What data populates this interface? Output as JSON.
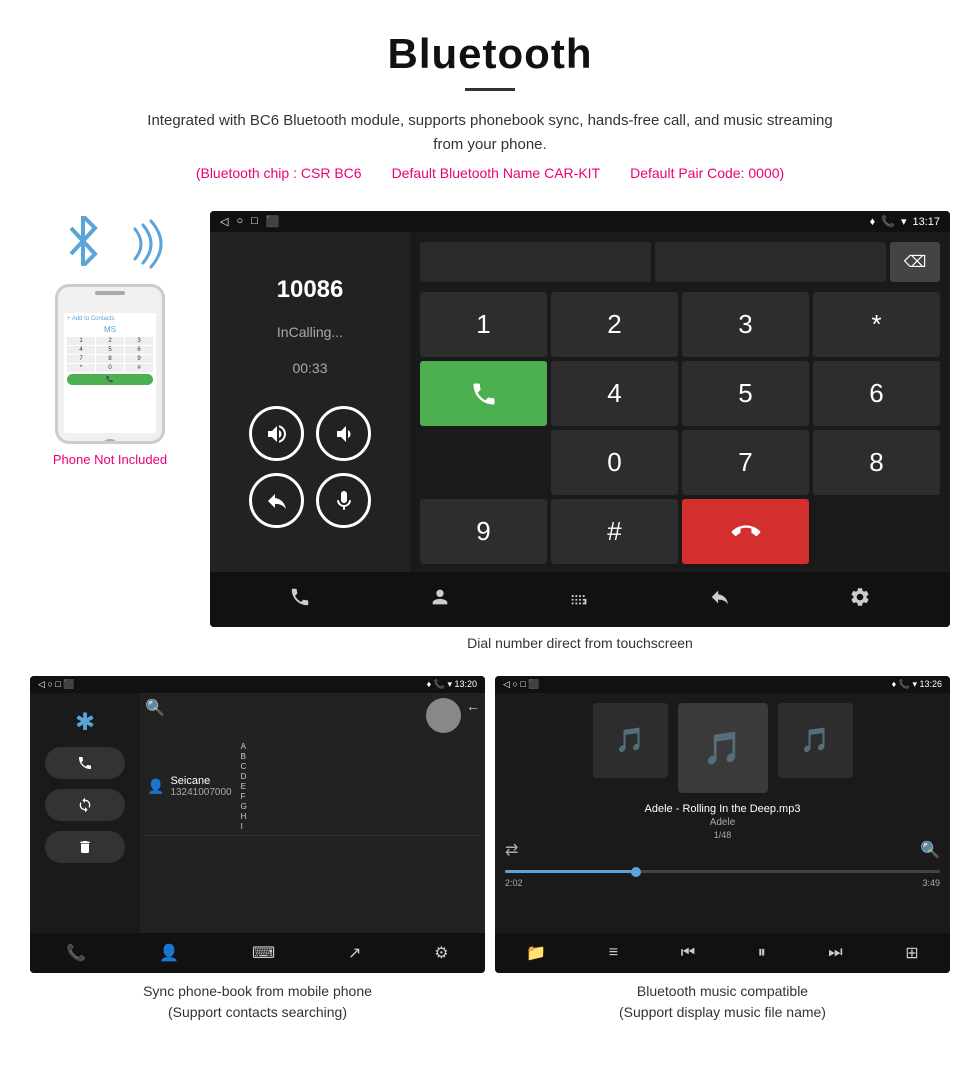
{
  "header": {
    "title": "Bluetooth",
    "description": "Integrated with BC6 Bluetooth module, supports phonebook sync, hands-free call, and music streaming from your phone.",
    "spec_chip": "(Bluetooth chip : CSR BC6",
    "spec_name": "Default Bluetooth Name CAR-KIT",
    "spec_code": "Default Pair Code: 0000)",
    "phone_not_included": "Phone Not Included"
  },
  "main_screen": {
    "statusbar": {
      "left_icons": [
        "◁",
        "○",
        "□",
        "⬛"
      ],
      "right_time": "13:17",
      "right_icons": [
        "♦",
        "📞",
        "▾"
      ]
    },
    "call": {
      "number": "10086",
      "status": "InCalling...",
      "timer": "00:33"
    },
    "keypad": {
      "keys": [
        "1",
        "2",
        "3",
        "*",
        "4",
        "5",
        "6",
        "0",
        "7",
        "8",
        "9",
        "#"
      ]
    },
    "caption": "Dial number direct from touchscreen"
  },
  "phonebook_screen": {
    "statusbar_right": "13:20",
    "contact_name": "Seicane",
    "contact_number": "13241007000",
    "alphabet": [
      "A",
      "B",
      "C",
      "D",
      "E",
      "F",
      "G",
      "H",
      "I"
    ],
    "caption_line1": "Sync phone-book from mobile phone",
    "caption_line2": "(Support contacts searching)"
  },
  "music_screen": {
    "statusbar_right": "13:26",
    "song_title": "Adele - Rolling In the Deep.mp3",
    "artist": "Adele",
    "track_info": "1/48",
    "time_current": "2:02",
    "time_total": "3:49",
    "caption_line1": "Bluetooth music compatible",
    "caption_line2": "(Support display music file name)"
  }
}
